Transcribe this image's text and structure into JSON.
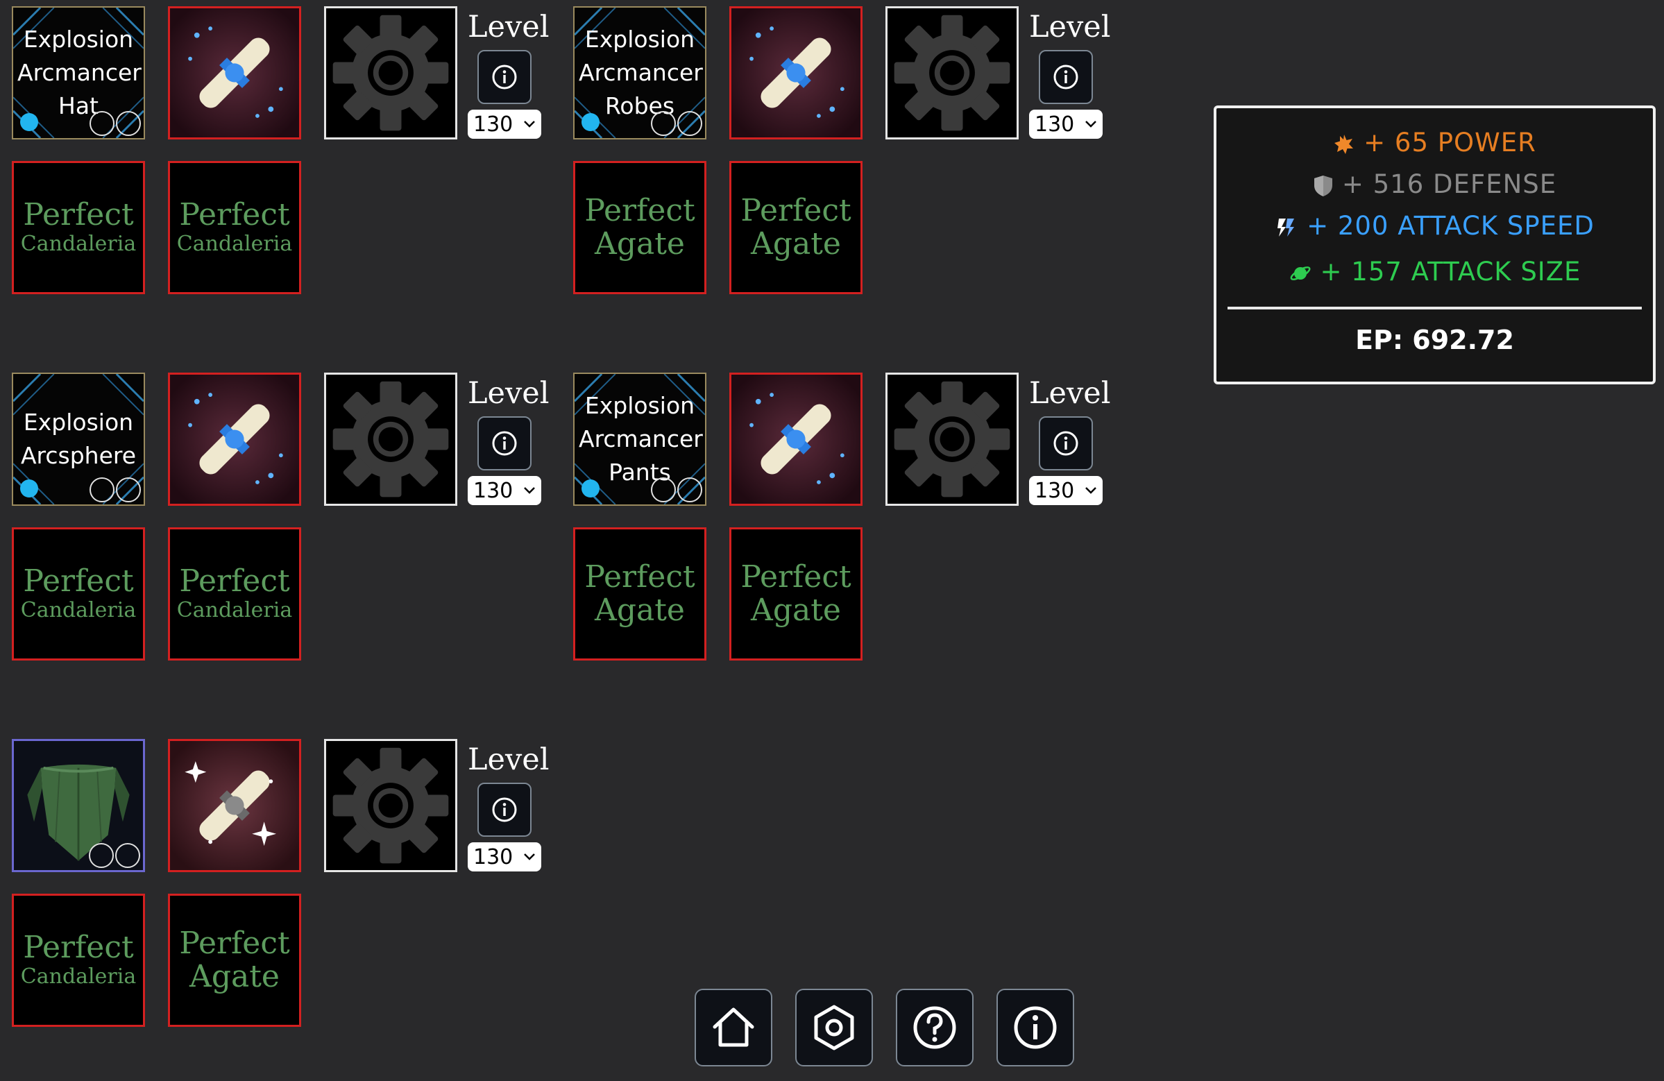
{
  "sets": [
    {
      "item_lines": [
        "Explosion",
        "Arcmancer",
        "Hat"
      ],
      "level_label": "Level",
      "level_value": "130",
      "gems": [
        {
          "line1": "Perfect",
          "line2": "Candaleria"
        },
        {
          "line1": "Perfect",
          "line2": "Candaleria"
        }
      ]
    },
    {
      "item_lines": [
        "Explosion",
        "Arcmancer",
        "Robes"
      ],
      "level_label": "Level",
      "level_value": "130",
      "gems": [
        {
          "line1": "Perfect",
          "line2": "Agate"
        },
        {
          "line1": "Perfect",
          "line2": "Agate"
        }
      ]
    },
    {
      "item_lines": [
        "Explosion",
        "Arcsphere"
      ],
      "level_label": "Level",
      "level_value": "130",
      "gems": [
        {
          "line1": "Perfect",
          "line2": "Candaleria"
        },
        {
          "line1": "Perfect",
          "line2": "Candaleria"
        }
      ]
    },
    {
      "item_lines": [
        "Explosion",
        "Arcmancer",
        "Pants"
      ],
      "level_label": "Level",
      "level_value": "130",
      "gems": [
        {
          "line1": "Perfect",
          "line2": "Agate"
        },
        {
          "line1": "Perfect",
          "line2": "Agate"
        }
      ]
    },
    {
      "item_lines": [],
      "level_label": "Level",
      "level_value": "130",
      "gems": [
        {
          "line1": "Perfect",
          "line2": "Candaleria"
        },
        {
          "line1": "Perfect",
          "line2": "Agate"
        }
      ]
    }
  ],
  "stats": {
    "power": {
      "text": "+ 65 POWER",
      "color": "#e67e22"
    },
    "defense": {
      "text": "+ 516 DEFENSE",
      "color": "#8a8a8a"
    },
    "attack_speed": {
      "text": "+ 200 ATTACK SPEED",
      "color": "#3aa0ff"
    },
    "attack_size": {
      "text": "+ 157 ATTACK SIZE",
      "color": "#2ecc50"
    },
    "ep": "EP: 692.72"
  },
  "nav": [
    "home-icon",
    "settings-icon",
    "help-icon",
    "info-icon"
  ]
}
